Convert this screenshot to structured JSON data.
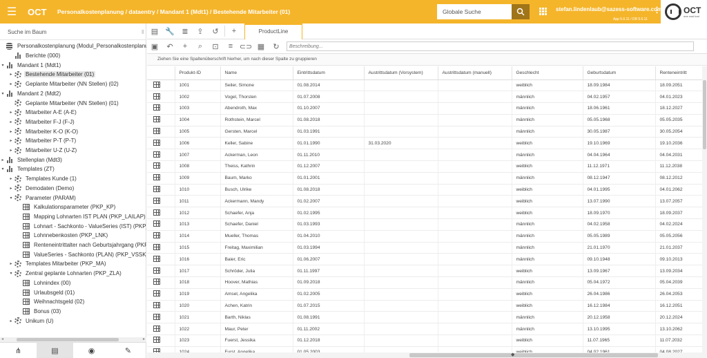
{
  "header": {
    "menu_icon": "menu-icon",
    "app_title": "OCT",
    "breadcrumb": "Personalkostenplanung / dataentry / Mandant 1 (Mdt1) / Bestehende Mitarbeiter (01)",
    "search_placeholder": "Globale Suche",
    "user": "stefan.lindenlaub@sazess-software.com",
    "version": "App 5.6.11 / DB 5.6.11",
    "logo_name": "OCT",
    "logo_tagline": "one cool tool",
    "accent_color": "#f5b52a"
  },
  "sidebar": {
    "search_label": "Suche im Baum",
    "tree": [
      {
        "label": "Personalkostenplanung (Modul_Personalkostenplanung_Dat",
        "icon": "database",
        "twisty": "",
        "level": 0
      },
      {
        "label": "Berichte (000)",
        "icon": "chart",
        "twisty": "",
        "level": 1
      },
      {
        "label": "Mandant 1 (Mdt1)",
        "icon": "chart",
        "twisty": "▾",
        "level": 0
      },
      {
        "label": "Bestehende Mitarbeiter (01)",
        "icon": "gear",
        "twisty": "▸",
        "level": 1,
        "selected": true
      },
      {
        "label": "Geplante Mitarbeiter (NN Stellen) (02)",
        "icon": "gear",
        "twisty": "▸",
        "level": 1
      },
      {
        "label": "Mandant 2 (Mdt2)",
        "icon": "chart",
        "twisty": "▾",
        "level": 0
      },
      {
        "label": "Geplante Mitarbeiter (NN Stellen) (01)",
        "icon": "gear",
        "twisty": "",
        "level": 1
      },
      {
        "label": "Mitarbeiter A-E (A-E)",
        "icon": "gear",
        "twisty": "▸",
        "level": 1
      },
      {
        "label": "Mitarbeiter F-J (F-J)",
        "icon": "gear",
        "twisty": "▸",
        "level": 1
      },
      {
        "label": "Mitarbeiter K-O (K-O)",
        "icon": "gear",
        "twisty": "▸",
        "level": 1
      },
      {
        "label": "Mitarbeiter P-T (P-T)",
        "icon": "gear",
        "twisty": "▸",
        "level": 1
      },
      {
        "label": "Mitarbeiter U-Z (U-Z)",
        "icon": "gear",
        "twisty": "▸",
        "level": 1
      },
      {
        "label": "Stellenplan (Mdt3)",
        "icon": "chart",
        "twisty": "▸",
        "level": 0
      },
      {
        "label": "Templates (ZT)",
        "icon": "chart",
        "twisty": "▾",
        "level": 0
      },
      {
        "label": "Templates Kunde (1)",
        "icon": "gear",
        "twisty": "▸",
        "level": 1
      },
      {
        "label": "Demodaten (Demo)",
        "icon": "gear",
        "twisty": "▸",
        "level": 1
      },
      {
        "label": "Parameter (PARAM)",
        "icon": "gear",
        "twisty": "▾",
        "level": 1
      },
      {
        "label": "Kalkulationsparameter (PKP_KP)",
        "icon": "table",
        "twisty": "",
        "level": 2
      },
      {
        "label": "Mapping Lohnarten IST PLAN (PKP_LAILAP)",
        "icon": "table",
        "twisty": "",
        "level": 2
      },
      {
        "label": "Lohnart - Sachkonto - ValueSeries (IST) (PKP_LASKV",
        "icon": "table",
        "twisty": "",
        "level": 2
      },
      {
        "label": "Lohnnebenkosten (PKP_LNK)",
        "icon": "table",
        "twisty": "",
        "level": 2
      },
      {
        "label": "Renteneintrittalter nach Geburtsjahrgang (PKP_REN",
        "icon": "table",
        "twisty": "",
        "level": 2
      },
      {
        "label": "ValueSeries - Sachkonto (PLAN) (PKP_VSSK)",
        "icon": "table",
        "twisty": "",
        "level": 2
      },
      {
        "label": "Templates Mitarbeiter (PKP_MA)",
        "icon": "gear",
        "twisty": "▸",
        "level": 1
      },
      {
        "label": "Zentral geplante Lohnarten (PKP_ZLA)",
        "icon": "gear",
        "twisty": "▾",
        "level": 1
      },
      {
        "label": "Lohnindex (00)",
        "icon": "table",
        "twisty": "",
        "level": 2
      },
      {
        "label": "Urlaubsgeld (01)",
        "icon": "table",
        "twisty": "",
        "level": 2
      },
      {
        "label": "Weihnachtsgeld (02)",
        "icon": "table",
        "twisty": "",
        "level": 2
      },
      {
        "label": "Bonus (03)",
        "icon": "table",
        "twisty": "",
        "level": 2
      },
      {
        "label": "Unikum (U)",
        "icon": "gear",
        "twisty": "▸",
        "level": 1
      }
    ],
    "bottom_tabs": [
      {
        "icon": "hierarchy-icon",
        "glyph": "⋔"
      },
      {
        "icon": "grid-view-icon",
        "glyph": "▤",
        "active": true
      },
      {
        "icon": "eye-icon",
        "glyph": "◉"
      },
      {
        "icon": "wrench-icon",
        "glyph": "✎"
      }
    ]
  },
  "main": {
    "product_tab": "ProductLine",
    "description_placeholder": "Beschreibung...",
    "group_hint": "Ziehen Sie eine Spaltenüberschrift hierher, um nach dieser Spalte zu gruppieren",
    "columns": [
      "",
      "Produkt-ID",
      "Name",
      "Eintrittsdatum",
      "Austrittsdatum (Vorsystem)",
      "Austrittsdatum (manuell)",
      "Geschlecht",
      "Geburtsdatum",
      "Renteneintritt"
    ],
    "rows": [
      [
        "1001",
        "Seiler, Simone",
        "01.08.2014",
        "",
        "",
        "weiblich",
        "18.09.1984",
        "18.09.2051"
      ],
      [
        "1002",
        "Vogel, Thorsten",
        "01.07.2008",
        "",
        "",
        "männlich",
        "04.02.1957",
        "04.01.2023"
      ],
      [
        "1003",
        "Abendroth, Max",
        "01.10.2007",
        "",
        "",
        "männlich",
        "18.06.1961",
        "18.12.2027"
      ],
      [
        "1004",
        "Rothstein, Marcel",
        "01.08.2018",
        "",
        "",
        "männlich",
        "05.05.1968",
        "05.05.2035"
      ],
      [
        "1005",
        "Gersten, Marcel",
        "01.03.1991",
        "",
        "",
        "männlich",
        "30.05.1987",
        "30.05.2054"
      ],
      [
        "1006",
        "Keller, Sabine",
        "01.01.1990",
        "31.03.2020",
        "",
        "weiblich",
        "19.10.1969",
        "19.10.2036"
      ],
      [
        "1007",
        "Ackerman, Leon",
        "01.11.2010",
        "",
        "",
        "männlich",
        "04.04.1964",
        "04.04.2031"
      ],
      [
        "1008",
        "Theiss, Kathrin",
        "01.12.2007",
        "",
        "",
        "weiblich",
        "11.12.1971",
        "11.12.2038"
      ],
      [
        "1009",
        "Baum, Marko",
        "01.01.2001",
        "",
        "",
        "männlich",
        "08.12.1947",
        "08.12.2012"
      ],
      [
        "1010",
        "Busch, Ulrike",
        "01.08.2018",
        "",
        "",
        "weiblich",
        "04.01.1995",
        "04.01.2062"
      ],
      [
        "1011",
        "Ackermann, Mandy",
        "01.02.2007",
        "",
        "",
        "weiblich",
        "13.07.1990",
        "13.07.2057"
      ],
      [
        "1012",
        "Schaefer, Anja",
        "01.02.1995",
        "",
        "",
        "weiblich",
        "18.09.1970",
        "18.09.2037"
      ],
      [
        "1013",
        "Schaefer, Daniel",
        "01.03.1993",
        "",
        "",
        "männlich",
        "04.02.1958",
        "04.02.2024"
      ],
      [
        "1014",
        "Mueller, Thomas",
        "01.04.2010",
        "",
        "",
        "männlich",
        "05.05.1989",
        "05.05.2056"
      ],
      [
        "1015",
        "Freitag, Maximilian",
        "01.03.1994",
        "",
        "",
        "männlich",
        "21.01.1970",
        "21.01.2037"
      ],
      [
        "1016",
        "Baier, Eric",
        "01.06.2007",
        "",
        "",
        "männlich",
        "09.10.1948",
        "09.10.2013"
      ],
      [
        "1017",
        "Schröder, Julia",
        "01.11.1997",
        "",
        "",
        "weiblich",
        "13.09.1967",
        "13.09.2034"
      ],
      [
        "1018",
        "Hoover, Mathias",
        "01.09.2018",
        "",
        "",
        "männlich",
        "05.04.1972",
        "05.04.2039"
      ],
      [
        "1019",
        "Amsel, Angelika",
        "01.02.2005",
        "",
        "",
        "weiblich",
        "26.04.1986",
        "26.04.2053"
      ],
      [
        "1020",
        "Achen, Katrin",
        "01.07.2015",
        "",
        "",
        "weiblich",
        "16.12.1984",
        "16.12.2051"
      ],
      [
        "1021",
        "Barth, Niklas",
        "01.08.1991",
        "",
        "",
        "männlich",
        "20.12.1958",
        "20.12.2024"
      ],
      [
        "1022",
        "Maur, Peter",
        "01.11.2002",
        "",
        "",
        "männlich",
        "13.10.1995",
        "13.10.2062"
      ],
      [
        "1023",
        "Fuerst, Jessika",
        "01.12.2018",
        "",
        "",
        "weiblich",
        "11.07.1965",
        "11.07.2032"
      ],
      [
        "1024",
        "Furst, Angelika",
        "01.05.2003",
        "",
        "",
        "weiblich",
        "04.02.1961",
        "04.08.2027"
      ]
    ]
  }
}
